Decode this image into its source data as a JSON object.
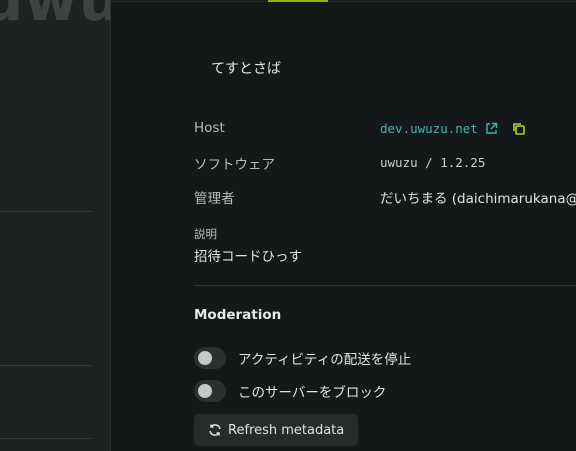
{
  "sidebar": {
    "logo_text": "uwuzu",
    "nav_fragment": "⁄"
  },
  "instance": {
    "name": "てすとさば",
    "host_label": "Host",
    "host_value": "dev.uwuzu.net",
    "software_label": "ソフトウェア",
    "software_value": "uwuzu / 1.2.25",
    "admin_label": "管理者",
    "admin_value": "だいちまる (daichimarukana@g",
    "description_label": "説明",
    "description_value": "招待コードひっす"
  },
  "moderation": {
    "title": "Moderation",
    "suspend_label": "アクティビティの配送を停止",
    "suspend_enabled": false,
    "block_label": "このサーバーをブロック",
    "block_enabled": false,
    "refresh_label": "Refresh metadata"
  },
  "colors": {
    "accent": "#8fae1b",
    "link": "#3fb6b0",
    "copy_icon": "#b5d325",
    "background": "#141818"
  },
  "icons": {
    "external": "external-link-icon",
    "copy": "copy-icon",
    "refresh": "refresh-icon"
  }
}
